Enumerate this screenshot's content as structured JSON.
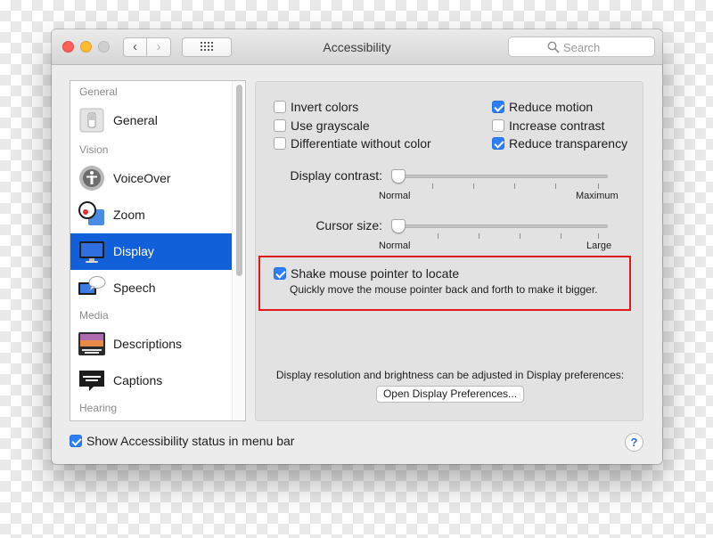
{
  "window": {
    "title": "Accessibility",
    "search_placeholder": "Search",
    "nav_back_icon": "chevron-left",
    "nav_forward_icon": "chevron-right"
  },
  "sidebar": {
    "sections": [
      "General",
      "Vision",
      "Media",
      "Hearing"
    ],
    "items": [
      {
        "label": "General",
        "icon": "switch-icon"
      },
      {
        "label": "VoiceOver",
        "icon": "voiceover-icon"
      },
      {
        "label": "Zoom",
        "icon": "magnifier-icon"
      },
      {
        "label": "Display",
        "icon": "monitor-icon",
        "selected": true
      },
      {
        "label": "Speech",
        "icon": "speech-bubble-icon"
      },
      {
        "label": "Descriptions",
        "icon": "descriptions-icon"
      },
      {
        "label": "Captions",
        "icon": "captions-icon"
      }
    ]
  },
  "display": {
    "options_left": [
      {
        "label": "Invert colors",
        "checked": false
      },
      {
        "label": "Use grayscale",
        "checked": false
      },
      {
        "label": "Differentiate without color",
        "checked": false
      }
    ],
    "options_right": [
      {
        "label": "Reduce motion",
        "checked": true
      },
      {
        "label": "Increase contrast",
        "checked": false
      },
      {
        "label": "Reduce transparency",
        "checked": true
      }
    ],
    "contrast": {
      "label": "Display contrast:",
      "min_label": "Normal",
      "max_label": "Maximum",
      "value": 0
    },
    "cursor": {
      "label": "Cursor size:",
      "min_label": "Normal",
      "max_label": "Large",
      "value": 0
    },
    "shake": {
      "label": "Shake mouse pointer to locate",
      "description": "Quickly move the mouse pointer back and forth to make it bigger.",
      "checked": true
    },
    "resolution_note": "Display resolution and brightness can be adjusted in Display preferences:",
    "open_button": "Open Display Preferences..."
  },
  "footer": {
    "status_label": "Show Accessibility status in menu bar",
    "status_checked": true,
    "help": "?"
  },
  "colors": {
    "selection": "#1160d9",
    "checkbox_accent": "#2d7ef7",
    "highlight_border": "#e0191b"
  }
}
